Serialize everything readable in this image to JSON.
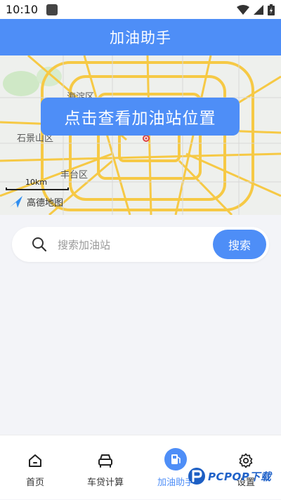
{
  "status_bar": {
    "time": "10:10"
  },
  "header": {
    "title": "加油助手"
  },
  "map": {
    "labels": [
      "海淀区",
      "石景山区",
      "丰台区"
    ],
    "scale_label": "10km",
    "provider": "高德地图",
    "cta_label": "点击查看加油站位置"
  },
  "search": {
    "placeholder": "搜索加油站",
    "value": "",
    "button_label": "搜索"
  },
  "tabbar": {
    "items": [
      {
        "label": "首页",
        "icon": "home-icon",
        "active": false
      },
      {
        "label": "车贷计算",
        "icon": "car-icon",
        "active": false
      },
      {
        "label": "加油助手",
        "icon": "fuel-pump-icon",
        "active": true
      },
      {
        "label": "设置",
        "icon": "gear-icon",
        "active": false
      }
    ]
  },
  "watermark": {
    "text": "PCPOP下载"
  },
  "colors": {
    "primary": "#4e8ef7",
    "road": "#f6c945",
    "background": "#f3f4f8"
  }
}
